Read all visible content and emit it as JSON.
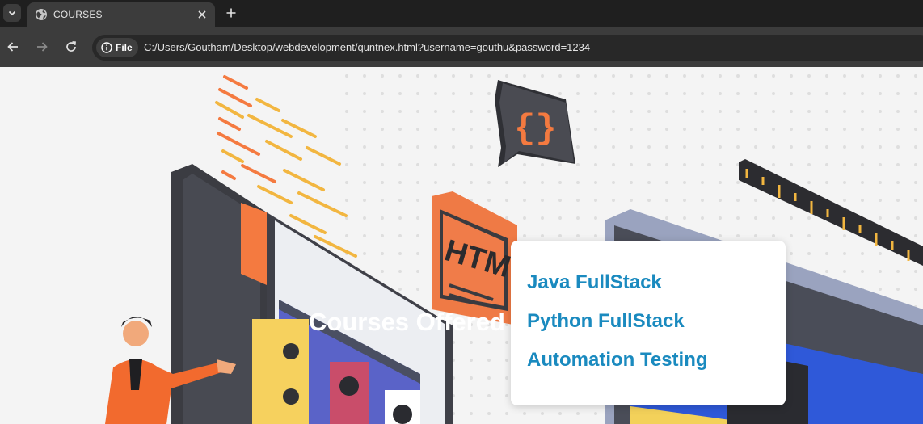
{
  "browser": {
    "tab_title": "COURSES",
    "url_chip_label": "File",
    "url": "C:/Users/Goutham/Desktop/webdevelopment/quntnex.html?username=gouthu&password=1234",
    "icons": [
      "tab-list-icon",
      "globe-icon",
      "close-icon",
      "plus-icon",
      "back-arrow-icon",
      "forward-arrow-icon",
      "reload-icon",
      "info-icon"
    ]
  },
  "page": {
    "headline": "Courses Offered",
    "courses": [
      "Java FullStack",
      "Python FullStack",
      "Automation Testing"
    ]
  },
  "colors": {
    "link": "#1a8abf",
    "chrome_dark": "#1f1f1f",
    "chrome_toolbar": "#3c3c3c",
    "accent_orange": "#f47a40"
  }
}
